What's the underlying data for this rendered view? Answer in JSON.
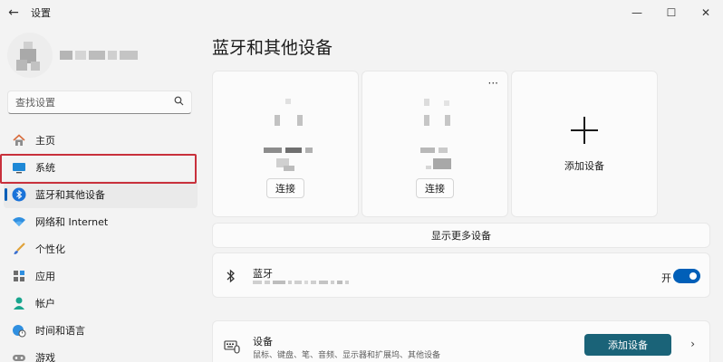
{
  "window": {
    "title": "设置",
    "back": "←",
    "controls": {
      "minimize": "—",
      "maximize": "☐",
      "close": "✕"
    }
  },
  "search": {
    "placeholder": "查找设置",
    "icon": "search-icon"
  },
  "sidebar": {
    "items": [
      {
        "label": "主页",
        "icon": "home-icon"
      },
      {
        "label": "系统",
        "icon": "monitor-icon"
      },
      {
        "label": "蓝牙和其他设备",
        "icon": "bluetooth-icon",
        "active": true
      },
      {
        "label": "网络和 Internet",
        "icon": "wifi-icon"
      },
      {
        "label": "个性化",
        "icon": "brush-icon"
      },
      {
        "label": "应用",
        "icon": "apps-icon"
      },
      {
        "label": "帐户",
        "icon": "account-icon"
      },
      {
        "label": "时间和语言",
        "icon": "globe-clock-icon"
      },
      {
        "label": "游戏",
        "icon": "gamepad-icon"
      }
    ]
  },
  "main": {
    "title": "蓝牙和其他设备",
    "device_cards": [
      {
        "connect_label": "连接"
      },
      {
        "connect_label": "连接",
        "more": "···"
      }
    ],
    "add_card_label": "添加设备",
    "show_more_label": "显示更多设备",
    "bluetooth": {
      "title": "蓝牙",
      "toggle_label": "开",
      "on": true
    },
    "devices": {
      "title": "设备",
      "subtitle": "鼠标、键盘、笔、音频、显示器和扩展坞、其他设备",
      "add_button": "添加设备",
      "chevron": "›"
    }
  },
  "colors": {
    "accent": "#005fb8",
    "add_button": "#1a6378",
    "highlight_box": "#c8303b",
    "background": "#f3f3f3"
  }
}
